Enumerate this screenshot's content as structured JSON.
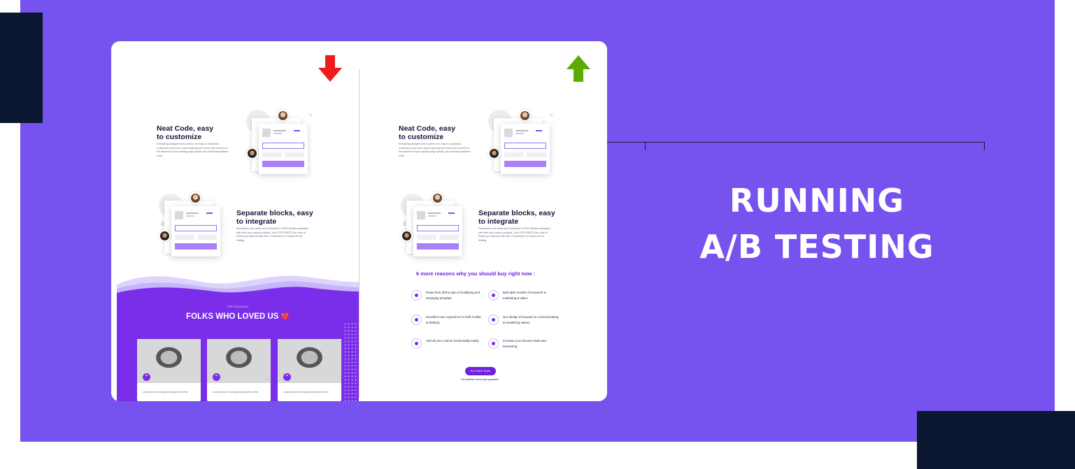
{
  "headline": {
    "line1": "RUNNING",
    "line2": "A/B TESTING"
  },
  "colors": {
    "background": "#7652ee",
    "navy": "#0b1730",
    "variant_a_arrow": "#ee1c1c",
    "variant_b_arrow": "#5aac00",
    "accent": "#6e22dc"
  },
  "variant_a": {
    "indicator": "arrow-down-icon",
    "block1": {
      "title_line1": "Neat Code, easy",
      "title_line2": "to customize",
      "desc": "Everything designed and coded to be easy to customize. Customize your fonts, colors spacing and move code around on the backend of your landing page quickly. No confusing backend code."
    },
    "block2": {
      "title_line1": "Separate blocks,  easy",
      "title_line2": "to integrate",
      "desc": "Developers can easily use Frontendor's HTML Blocks separately with their own custom projects. Just COPY-PASTE the code of blocks you liked just like that. Frontendor's is simple yet not limiting."
    },
    "testimonials": {
      "label": "TESTIMONIALS",
      "title": "FOLKS WHO LOVED US",
      "heart": "❤️",
      "cards": [
        {
          "text": "Lorem Ipsum is simply dummy text of the"
        },
        {
          "text": "Lorem Ipsum is simply dummy text of the"
        },
        {
          "text": "Lorem Ipsum is simply dummy text of the"
        }
      ]
    }
  },
  "variant_b": {
    "indicator": "arrow-up-icon",
    "block1": {
      "title_line1": "Neat  Code, easy",
      "title_line2": "to customize",
      "desc": "Everything designed and coded to be easy to customize. Customize your fonts, colors spacing and move code around on the backend of your landing page quickly. No confusing backend code."
    },
    "block2": {
      "title_line1": "Separate blocks,  easy",
      "title_line2": "to integrate",
      "desc": "Developers can easily use Frontendor's HTML Blocks separately with their own custom projects. Just COPY-PASTE the code of blocks you liked just like that. Frontendor's is simple yet not limiting."
    },
    "reasons_title": "6 more reasons why you should buy right now :",
    "reasons": [
      {
        "text": "Relax from all the pain of modifying and arranging template."
      },
      {
        "text": "Built after months of research in marketing & sales."
      },
      {
        "text": "Excellent user experience in both mobile & desktop."
      },
      {
        "text": "Our design is focused on communicating & visualizing values."
      },
      {
        "text": "Add all your custom functionality easily."
      },
      {
        "text": "Increase your Bounce Rate and interacting."
      }
    ],
    "buy_button": "BUY RIGHT NOW",
    "guarantee": "Not satisfied! money back guarantee"
  }
}
